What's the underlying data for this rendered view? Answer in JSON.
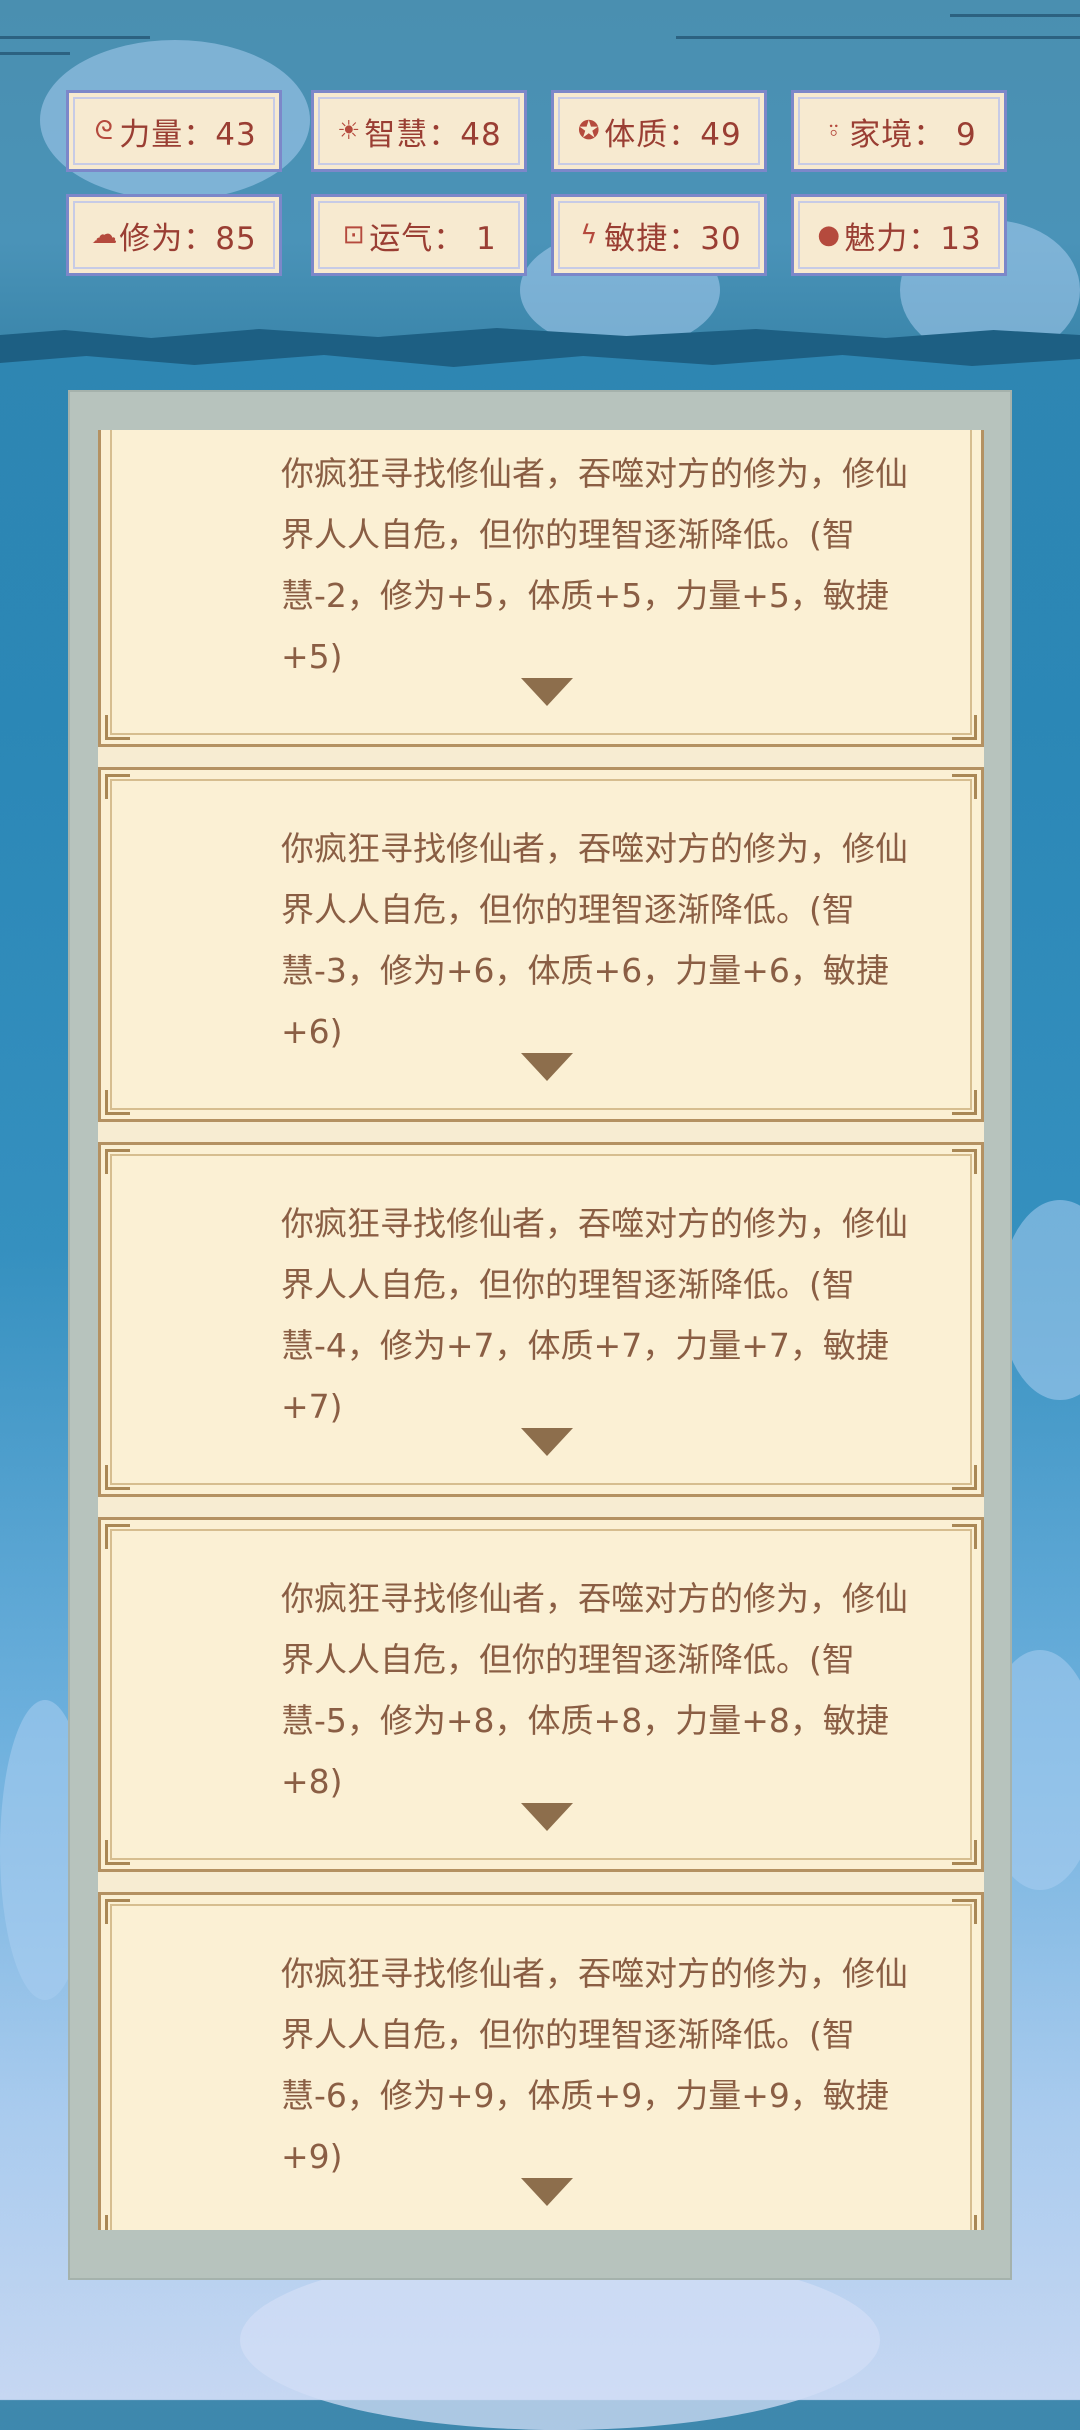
{
  "stats": [
    {
      "icon": "muscle-icon",
      "glyph": "ᘓ",
      "label": "力量：43"
    },
    {
      "icon": "lightbulb-icon",
      "glyph": "☀",
      "label": "智慧：48"
    },
    {
      "icon": "body-icon",
      "glyph": "✪",
      "label": "体质：49"
    },
    {
      "icon": "family-icon",
      "glyph": "⍤",
      "label": "家境： 9"
    },
    {
      "icon": "cultivation-cloud-icon",
      "glyph": "☁",
      "label": "修为：85"
    },
    {
      "icon": "luck-icon",
      "glyph": "⊡",
      "label": "运气： 1"
    },
    {
      "icon": "lightning-icon",
      "glyph": "ϟ",
      "label": "敏捷：30"
    },
    {
      "icon": "charm-icon",
      "glyph": "●",
      "label": "魅力：13"
    }
  ],
  "events": [
    {
      "text": "你疯狂寻找修仙者，吞噬对方的修为，修仙界人人自危，但你的理智逐渐降低。(智慧-2，修为+5，体质+5，力量+5，敏捷+5)"
    },
    {
      "text": "你疯狂寻找修仙者，吞噬对方的修为，修仙界人人自危，但你的理智逐渐降低。(智慧-3，修为+6，体质+6，力量+6，敏捷+6)"
    },
    {
      "text": "你疯狂寻找修仙者，吞噬对方的修为，修仙界人人自危，但你的理智逐渐降低。(智慧-4，修为+7，体质+7，力量+7，敏捷+7)"
    },
    {
      "text": "你疯狂寻找修仙者，吞噬对方的修为，修仙界人人自危，但你的理智逐渐降低。(智慧-5，修为+8，体质+8，力量+8，敏捷+8)"
    },
    {
      "text": "你疯狂寻找修仙者，吞噬对方的修为，修仙界人人自危，但你的理智逐渐降低。(智慧-6，修为+9，体质+9，力量+9，敏捷+9)"
    }
  ]
}
